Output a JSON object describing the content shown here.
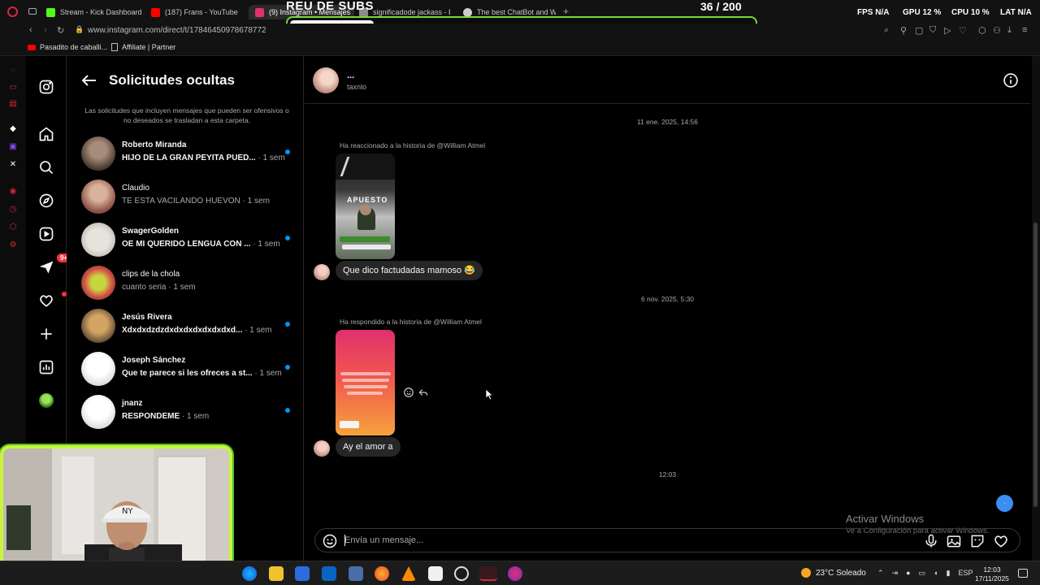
{
  "browser": {
    "tabs": [
      {
        "label": "Stream - Kick Dashboard",
        "icon": "kick-icon",
        "color": "#53fc18"
      },
      {
        "label": "(187) Frans - YouTube",
        "icon": "youtube-icon",
        "color": "#ff0000"
      },
      {
        "label": "(9) Instagram • Mensajes",
        "icon": "instagram-icon",
        "color": "#e1306c"
      },
      {
        "label": "significadode jackass - B",
        "icon": "search-icon",
        "color": "#8a8a8a"
      },
      {
        "label": "The best ChatBot and W",
        "icon": "bot-icon",
        "color": "#cccccc"
      }
    ],
    "url": "www.instagram.com/direct/t/17846450978678772",
    "bookmarks": [
      "Pasadito de caballi...",
      "Affiliate | Partner"
    ]
  },
  "hud": {
    "fps_label": "FPS",
    "fps_value": "N/A",
    "gpu_label": "GPU",
    "gpu_value": "12 %",
    "cpu_label": "CPU",
    "cpu_value": "10 %",
    "lat_label": "LAT",
    "lat_value": "N/A"
  },
  "stream_goal": {
    "title": "REU DE SUBS",
    "count": "36 / 200",
    "current": 36,
    "target": 200,
    "bar_color": "#6fdc3a"
  },
  "requests": {
    "title": "Solicitudes ocultas",
    "description": "Las solicitudes que incluyen mensajes que pueden ser ofensivos o no deseados se trasladan a esta carpeta.",
    "items": [
      {
        "name": "Roberto Miranda",
        "message": "HIJO DE LA GRAN PEYITA PUED...",
        "time": "· 1 sem",
        "unread": true
      },
      {
        "name": "Claudio",
        "message": "TE ESTA VACILANDO HUEVON",
        "time": "· 1 sem",
        "unread": false
      },
      {
        "name": "SwagerGolden",
        "message": "OE MI QUERIDO LENGUA CON ...",
        "time": "· 1 sem",
        "unread": true
      },
      {
        "name": "clips de la chola",
        "message": "cuanto seria",
        "time": "· 1 sem",
        "unread": false
      },
      {
        "name": "Jesús Rivera",
        "message": "Xdxdxdzdzdxdxdxdxdxdxdxd...",
        "time": "· 1 sem",
        "unread": true
      },
      {
        "name": "Joseph Sánchez",
        "message": "Que te parece si les ofreces a st...",
        "time": "· 1 sem",
        "unread": true
      },
      {
        "name": "jnanz",
        "message": "RESPONDEME",
        "time": "· 1 sem",
        "unread": true
      }
    ],
    "nav_badge": "9+"
  },
  "chat": {
    "name": "...",
    "username": "taxnlo",
    "timestamp_1": "11 ene. 2025, 14:56",
    "story_label_1": "Ha reaccionado a la historia de @William Atmel",
    "message_1": "Que dico factudadas mamoso 😂",
    "timestamp_2": "6 nov. 2025, 5:30",
    "story_label_2": "Ha respondido a la historia de @William Atmel",
    "message_2": "Ay el amor a",
    "timestamp_3": "12:03",
    "composer_placeholder": "Envía un mensaje...",
    "story_1_caption": "APUESTO"
  },
  "windows": {
    "activate_title": "Activar Windows",
    "activate_sub": "Ve a Configuración para activar Windows.",
    "weather": "23°C  Soleado",
    "lang": "ESP",
    "time": "12:03",
    "date": "17/11/2025"
  }
}
